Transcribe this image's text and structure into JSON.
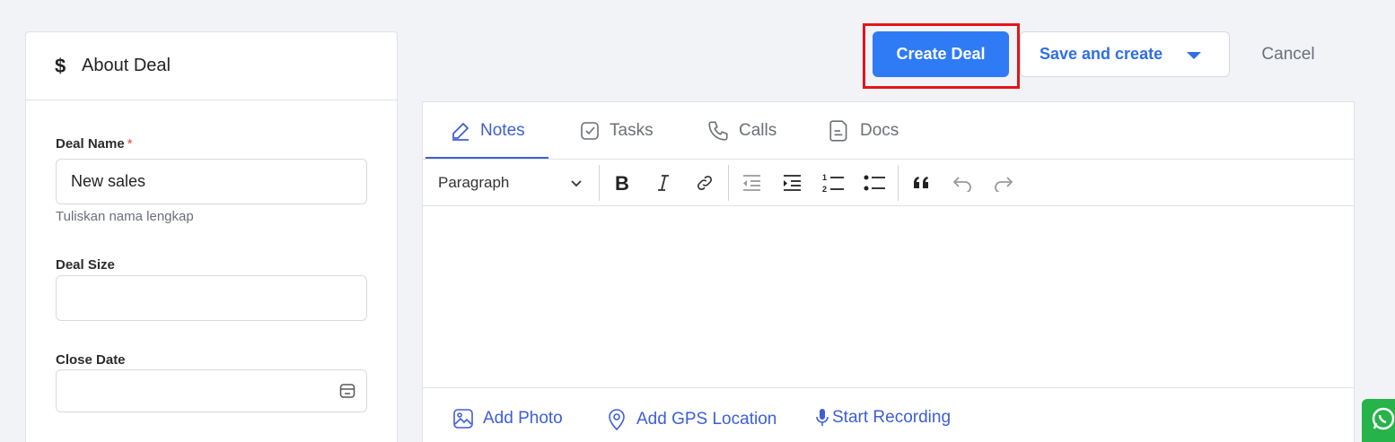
{
  "left_panel": {
    "title": "About Deal",
    "deal_name": {
      "label": "Deal Name",
      "required_mark": "*",
      "value": "New sales",
      "hint": "Tuliskan nama lengkap"
    },
    "deal_size": {
      "label": "Deal Size",
      "value": ""
    },
    "close_date": {
      "label": "Close Date",
      "value": ""
    }
  },
  "actions": {
    "create": "Create Deal",
    "save_and_create": "Save and create",
    "cancel": "Cancel"
  },
  "tabs": [
    {
      "label": "Notes",
      "active": true
    },
    {
      "label": "Tasks",
      "active": false
    },
    {
      "label": "Calls",
      "active": false
    },
    {
      "label": "Docs",
      "active": false
    }
  ],
  "toolbar": {
    "block_format": "Paragraph"
  },
  "footer": {
    "add_photo": "Add Photo",
    "add_gps": "Add GPS Location",
    "start_recording": "Start Recording"
  },
  "colors": {
    "primary": "#2f7bf5",
    "accent": "#3d5ed6",
    "highlight": "#e3151a"
  }
}
